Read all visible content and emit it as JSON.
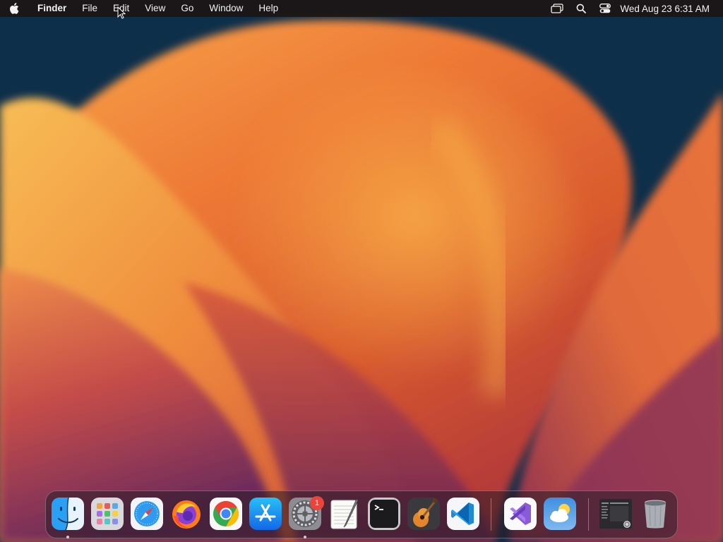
{
  "menubar": {
    "app_name": "Finder",
    "menus": [
      "File",
      "Edit",
      "View",
      "Go",
      "Window",
      "Help"
    ],
    "status_icons": [
      "display-mirroring-icon",
      "spotlight-icon",
      "control-center-icon"
    ],
    "clock": "Wed Aug 23  6:31 AM"
  },
  "dock": {
    "apps": [
      {
        "name": "Finder",
        "icon": "finder-icon",
        "running": true
      },
      {
        "name": "Launchpad",
        "icon": "launchpad-icon",
        "running": false
      },
      {
        "name": "Safari",
        "icon": "safari-icon",
        "running": false
      },
      {
        "name": "Firefox",
        "icon": "firefox-icon",
        "running": false
      },
      {
        "name": "Google Chrome",
        "icon": "chrome-icon",
        "running": false
      },
      {
        "name": "App Store",
        "icon": "app-store-icon",
        "running": false
      },
      {
        "name": "System Settings",
        "icon": "system-settings-icon",
        "running": true,
        "badge": "1"
      },
      {
        "name": "TextEdit",
        "icon": "textedit-icon",
        "running": false
      },
      {
        "name": "Terminal",
        "icon": "terminal-icon",
        "running": false
      },
      {
        "name": "GarageBand",
        "icon": "garageband-icon",
        "running": false
      },
      {
        "name": "Visual Studio Code",
        "icon": "vscode-icon",
        "running": false
      },
      {
        "name": "Visual Studio",
        "icon": "visual-studio-icon",
        "running": false
      },
      {
        "name": "Weather",
        "icon": "weather-icon",
        "running": false
      },
      {
        "name": "Recent document",
        "icon": "recent-document-icon",
        "running": false
      },
      {
        "name": "Trash",
        "icon": "trash-icon",
        "running": false
      }
    ]
  },
  "colors": {
    "accent": "#0a84ff",
    "badge": "#e8453c",
    "wallpaper_deep": "#0d2f4a",
    "wallpaper_orange": "#f0742e",
    "wallpaper_yellow": "#f9b54a",
    "wallpaper_purple": "#7a2a5c"
  }
}
